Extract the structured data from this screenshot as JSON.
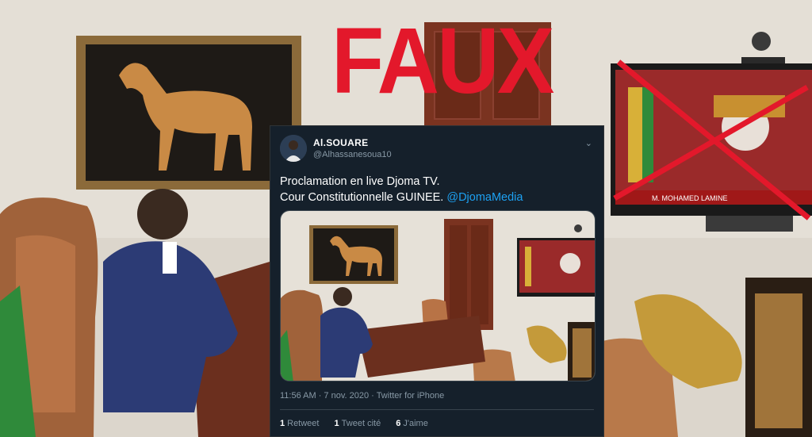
{
  "overlay": {
    "label": "FAUX",
    "color": "#e3182b"
  },
  "tweet": {
    "name": "Al.SOUARE",
    "handle": "@Alhassanesoua10",
    "menu_icon": "chevron-down-icon",
    "text_line1": "Proclamation en live Djoma TV.",
    "text_line2": "Cour Constitutionnelle GUINEE.",
    "mention": "@DjomaMedia",
    "timestamp": "11:56 AM · 7 nov. 2020 · Twitter for iPhone",
    "stats": [
      {
        "count": "1",
        "label": "Retweet"
      },
      {
        "count": "1",
        "label": "Tweet cité"
      },
      {
        "count": "6",
        "label": "J'aime"
      }
    ]
  },
  "tv_screen": {
    "caption": "M. MOHAMED LAMINE",
    "crossed_out": true
  }
}
